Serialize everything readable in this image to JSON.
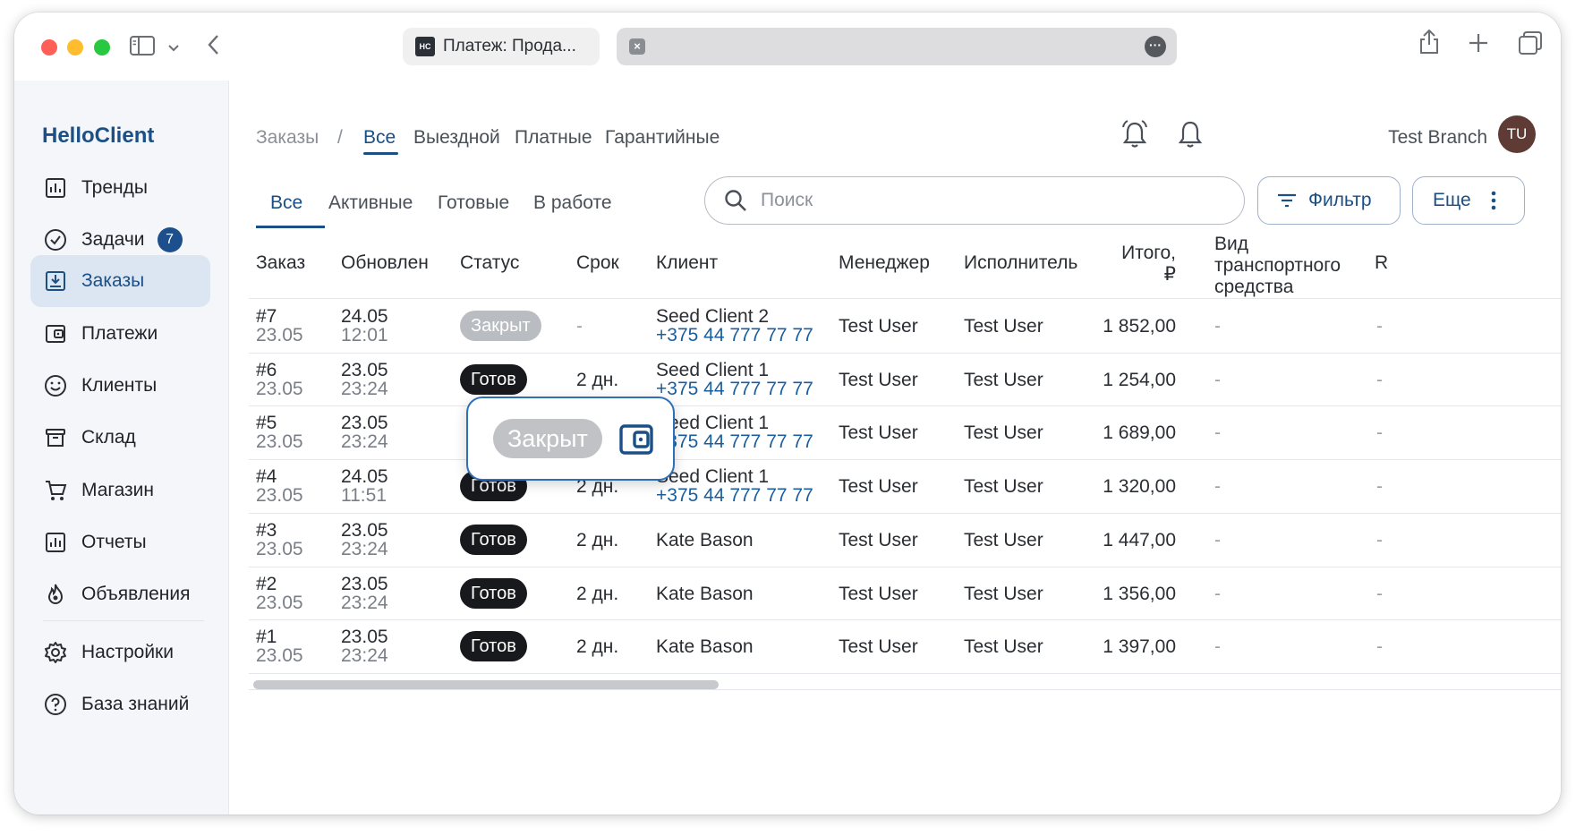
{
  "browser": {
    "favicon_text": "HC",
    "active_tab_title": "Платеж: Прода..."
  },
  "sidebar": {
    "brand": "HelloClient",
    "items": [
      {
        "label": "Тренды",
        "icon": "chart-icon"
      },
      {
        "label": "Задачи",
        "icon": "check-circle-icon",
        "badge": "7"
      },
      {
        "label": "Заказы",
        "icon": "download-box-icon",
        "active": true
      },
      {
        "label": "Платежи",
        "icon": "wallet-icon"
      },
      {
        "label": "Клиенты",
        "icon": "smile-icon"
      },
      {
        "label": "Склад",
        "icon": "archive-icon"
      },
      {
        "label": "Магазин",
        "icon": "cart-icon"
      },
      {
        "label": "Отчеты",
        "icon": "report-icon"
      },
      {
        "label": "Объявления",
        "icon": "flame-icon"
      }
    ],
    "bottom_items": [
      {
        "label": "Настройки",
        "icon": "gear-icon"
      },
      {
        "label": "База знаний",
        "icon": "help-icon"
      }
    ]
  },
  "header": {
    "breadcrumb_root": "Заказы",
    "separator": "/",
    "type_tabs": [
      "Все",
      "Выездной",
      "Платные",
      "Гарантийные"
    ],
    "branch": "Test Branch",
    "avatar_initials": "TU"
  },
  "toolbar": {
    "status_tabs": [
      "Все",
      "Активные",
      "Готовые",
      "В работе"
    ],
    "search_placeholder": "Поиск",
    "filter_label": "Фильтр",
    "more_label": "Еще"
  },
  "table": {
    "columns": {
      "order": "Заказ",
      "updated": "Обновлен",
      "status": "Статус",
      "term": "Срок",
      "client": "Клиент",
      "manager": "Менеджер",
      "executor": "Исполнитель",
      "total_line1": "Итого,",
      "total_line2": "₽",
      "vehicle_line1": "Вид",
      "vehicle_line2": "транспортного",
      "vehicle_line3": "средства",
      "extra": "R"
    },
    "rows": [
      {
        "id": "#7",
        "created": "23.05",
        "upd_date": "24.05",
        "upd_time": "12:01",
        "status": "Закрыт",
        "status_kind": "closed",
        "term": "-",
        "client": "Seed Client 2",
        "phone": "+375 44 777 77 77",
        "manager": "Test User",
        "executor": "Test User",
        "total": "1 852,00",
        "vehicle": "-",
        "extra": "-"
      },
      {
        "id": "#6",
        "created": "23.05",
        "upd_date": "23.05",
        "upd_time": "23:24",
        "status": "Готов",
        "status_kind": "ready",
        "term": "2 дн.",
        "client": "Seed Client 1",
        "phone": "+375 44 777 77 77",
        "manager": "Test User",
        "executor": "Test User",
        "total": "1 254,00",
        "vehicle": "-",
        "extra": "-"
      },
      {
        "id": "#5",
        "created": "23.05",
        "upd_date": "23.05",
        "upd_time": "23:24",
        "status": "",
        "status_kind": "hidden",
        "term": "",
        "client": "Seed Client 1",
        "phone": "+375 44 777 77 77",
        "manager": "Test User",
        "executor": "Test User",
        "total": "1 689,00",
        "vehicle": "-",
        "extra": "-"
      },
      {
        "id": "#4",
        "created": "23.05",
        "upd_date": "24.05",
        "upd_time": "11:51",
        "status": "Готов",
        "status_kind": "ready",
        "term": "2 дн.",
        "client": "Seed Client 1",
        "phone": "+375 44 777 77 77",
        "manager": "Test User",
        "executor": "Test User",
        "total": "1 320,00",
        "vehicle": "-",
        "extra": "-"
      },
      {
        "id": "#3",
        "created": "23.05",
        "upd_date": "23.05",
        "upd_time": "23:24",
        "status": "Готов",
        "status_kind": "ready",
        "term": "2 дн.",
        "client": "Kate Bason",
        "phone": "",
        "manager": "Test User",
        "executor": "Test User",
        "total": "1 447,00",
        "vehicle": "-",
        "extra": "-"
      },
      {
        "id": "#2",
        "created": "23.05",
        "upd_date": "23.05",
        "upd_time": "23:24",
        "status": "Готов",
        "status_kind": "ready",
        "term": "2 дн.",
        "client": "Kate Bason",
        "phone": "",
        "manager": "Test User",
        "executor": "Test User",
        "total": "1 356,00",
        "vehicle": "-",
        "extra": "-"
      },
      {
        "id": "#1",
        "created": "23.05",
        "upd_date": "23.05",
        "upd_time": "23:24",
        "status": "Готов",
        "status_kind": "ready",
        "term": "2 дн.",
        "client": "Kate Bason",
        "phone": "",
        "manager": "Test User",
        "executor": "Test User",
        "total": "1 397,00",
        "vehicle": "-",
        "extra": "-"
      }
    ]
  },
  "popup": {
    "status": "Закрыт",
    "icon": "wallet-icon"
  },
  "colors": {
    "accent": "#1b4f86",
    "link": "#1b5e9e",
    "status_ready": "#17191c",
    "status_closed": "#b9bcc0",
    "popup_border": "#2f6fb6"
  }
}
